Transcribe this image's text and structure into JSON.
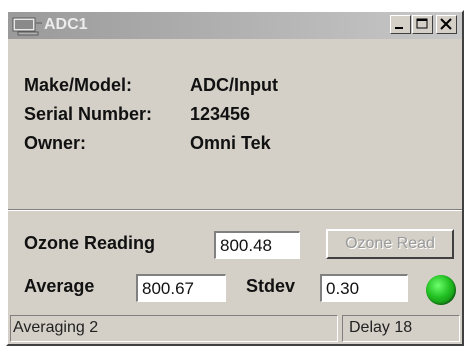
{
  "window": {
    "title": "ADC1",
    "controls": {
      "minimize": "minimize-icon",
      "maximize": "maximize-icon",
      "close": "close-icon"
    }
  },
  "info": {
    "make_model_label": "Make/Model:",
    "make_model_value": "ADC/Input",
    "serial_label": "Serial Number:",
    "serial_value": "123456",
    "owner_label": "Owner:",
    "owner_value": "Omni Tek"
  },
  "readings": {
    "ozone_label": "Ozone Reading",
    "ozone_value": "800.48",
    "ozone_read_button": "Ozone Read",
    "average_label": "Average",
    "average_value": "800.67",
    "stdev_label": "Stdev",
    "stdev_value": "0.30",
    "status_led_color": "#22c022"
  },
  "statusbar": {
    "left": "Averaging 2",
    "right": "Delay 18"
  }
}
